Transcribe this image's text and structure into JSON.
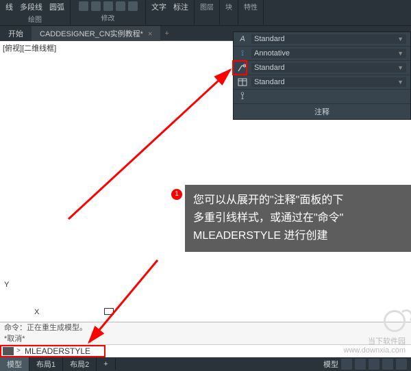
{
  "ribbon": {
    "groups": [
      {
        "label": "绘图",
        "items": [
          "线",
          "多段线",
          "圆弧"
        ]
      },
      {
        "label": "修改",
        "items": [
          "",
          "",
          ""
        ]
      },
      {
        "label": "",
        "items": [
          "文字",
          "标注"
        ]
      },
      {
        "label": "图层",
        "items": [
          ""
        ]
      },
      {
        "label": "块",
        "items": [
          ""
        ]
      },
      {
        "label": "特性",
        "items": [
          ""
        ]
      }
    ]
  },
  "tabs": {
    "start": "开始",
    "doc": "CADDESIGNER_CN实例教程*",
    "close": "×"
  },
  "viewport_label": "[俯视][二维线框]",
  "annotation_panel": {
    "rows": [
      {
        "icon": "A",
        "value": "Standard"
      },
      {
        "icon": "A",
        "value": "Annotative",
        "anno": true
      },
      {
        "icon": "leader-icon",
        "value": "Standard"
      },
      {
        "icon": "table-icon",
        "value": "Standard"
      }
    ],
    "footer": "注释"
  },
  "callout": {
    "badge": "1",
    "line1": "您可以从展开的\"注释\"面板的下",
    "line2": "多重引线样式，或通过在\"命令\"",
    "line3": "MLEADERSTYLE 进行创建"
  },
  "ucs_y": "Y",
  "ucs_x": "X",
  "command": {
    "hist1": "命令：正在重生成模型。",
    "hist2": "*取消*",
    "input": "MLEADERSTYLE"
  },
  "status": {
    "tabs": [
      "模型",
      "布局1",
      "布局2"
    ],
    "plus": "+",
    "right_label": "模型"
  },
  "watermark": {
    "title": "当下软件园",
    "url": "www.downxia.com"
  }
}
